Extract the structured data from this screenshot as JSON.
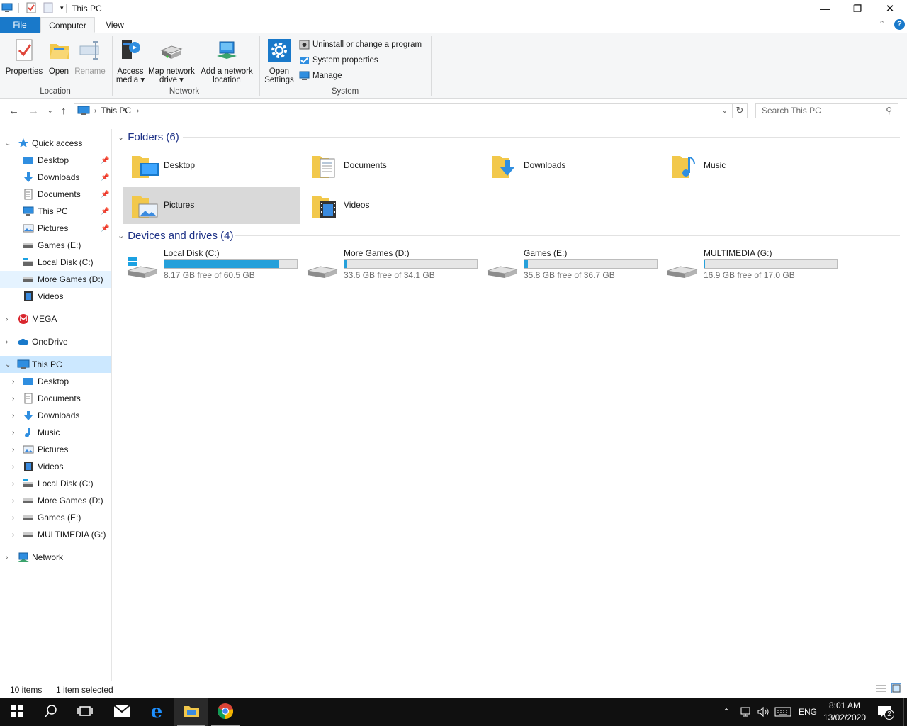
{
  "window": {
    "title": "This PC",
    "controls": {
      "minimize": "—",
      "maximize": "❐",
      "close": "✕"
    }
  },
  "ribbon": {
    "tabs": {
      "file": "File",
      "computer": "Computer",
      "view": "View"
    },
    "location": {
      "group_label": "Location",
      "properties": "Properties",
      "open": "Open",
      "rename": "Rename"
    },
    "network": {
      "group_label": "Network",
      "access_media": [
        "Access",
        "media ▾"
      ],
      "map_drive": [
        "Map network",
        "drive ▾"
      ],
      "add_location": [
        "Add a network",
        "location"
      ]
    },
    "system": {
      "group_label": "System",
      "open_settings": [
        "Open",
        "Settings"
      ],
      "uninstall": "Uninstall or change a program",
      "system_properties": "System properties",
      "manage": "Manage"
    }
  },
  "address": {
    "crumb": "This PC",
    "search_placeholder": "Search This PC"
  },
  "nav": {
    "quick_access": "Quick access",
    "quick_items": [
      {
        "label": "Desktop",
        "pinned": true
      },
      {
        "label": "Downloads",
        "pinned": true
      },
      {
        "label": "Documents",
        "pinned": true
      },
      {
        "label": "This PC",
        "pinned": true
      },
      {
        "label": "Pictures",
        "pinned": true
      },
      {
        "label": "Games (E:)"
      },
      {
        "label": "Local Disk (C:)"
      },
      {
        "label": "More Games (D:)"
      },
      {
        "label": "Videos"
      }
    ],
    "mega": "MEGA",
    "onedrive": "OneDrive",
    "this_pc": "This PC",
    "pc_items": [
      "Desktop",
      "Documents",
      "Downloads",
      "Music",
      "Pictures",
      "Videos",
      "Local Disk (C:)",
      "More Games (D:)",
      "Games (E:)",
      "MULTIMEDIA (G:)"
    ],
    "network": "Network"
  },
  "content": {
    "folders_header": "Folders (6)",
    "folders": [
      "Desktop",
      "Documents",
      "Downloads",
      "Music",
      "Pictures",
      "Videos"
    ],
    "drives_header": "Devices and drives (4)",
    "drives": [
      {
        "name": "Local Disk (C:)",
        "free": "8.17 GB free of 60.5 GB",
        "used_fraction": 0.865
      },
      {
        "name": "More Games (D:)",
        "free": "33.6 GB free of 34.1 GB",
        "used_fraction": 0.015
      },
      {
        "name": "Games (E:)",
        "free": "35.8 GB free of 36.7 GB",
        "used_fraction": 0.025
      },
      {
        "name": "MULTIMEDIA (G:)",
        "free": "16.9 GB free of 17.0 GB",
        "used_fraction": 0.006
      }
    ]
  },
  "status": {
    "items": "10 items",
    "selected": "1 item selected"
  },
  "taskbar": {
    "lang": "ENG",
    "time": "8:01 AM",
    "date": "13/02/2020",
    "notifications": "2"
  },
  "colors": {
    "accent": "#1979ca",
    "drive_bar": "#26a0da",
    "selection": "#cce8ff",
    "folder": "#f2c84b"
  }
}
